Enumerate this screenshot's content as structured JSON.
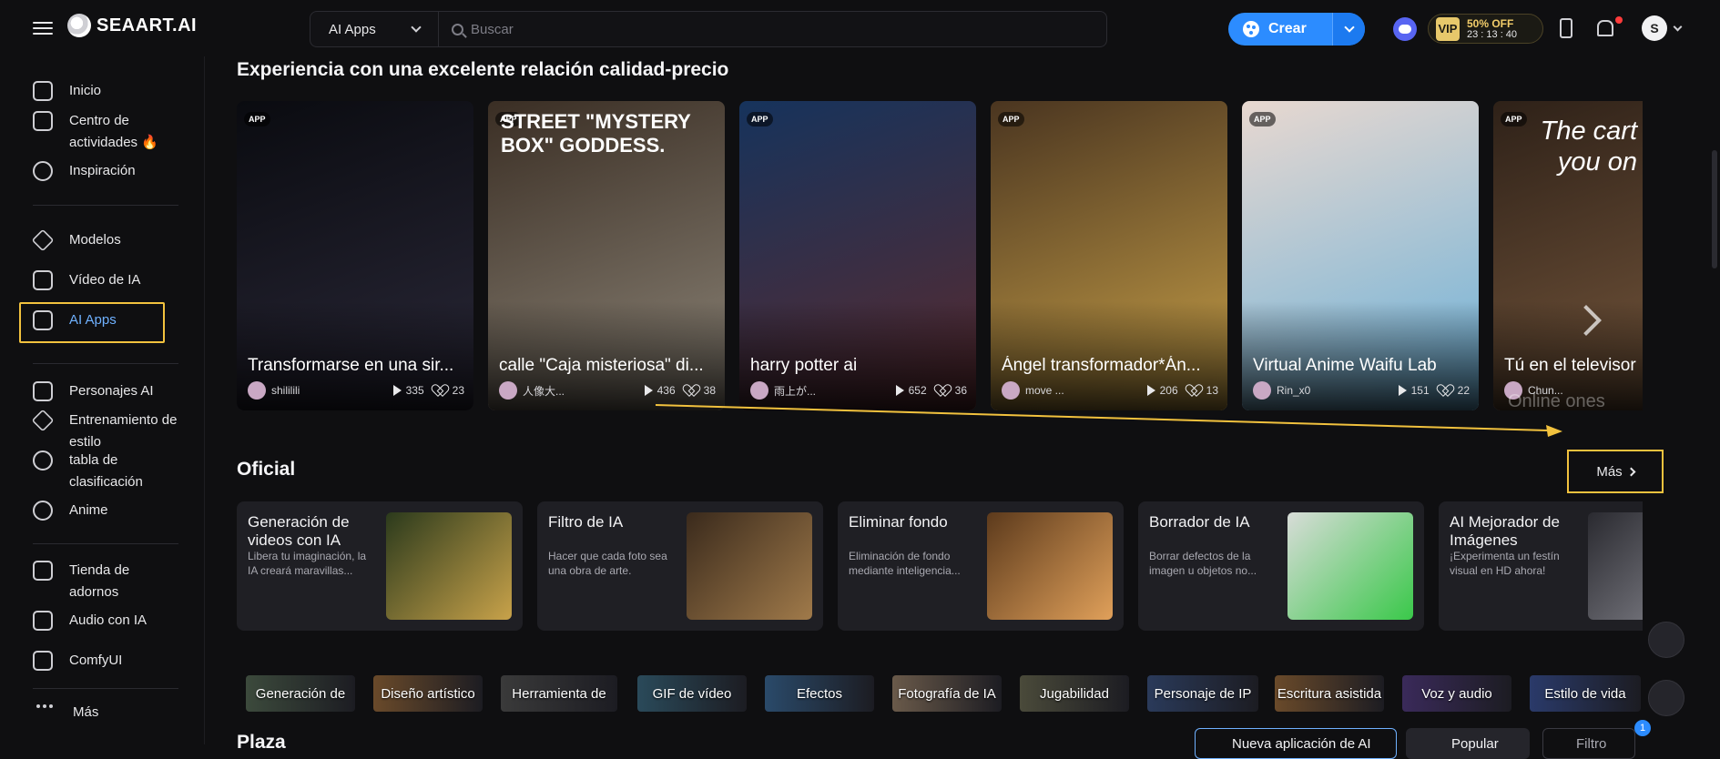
{
  "brand": {
    "name": "SEAART.AI"
  },
  "header": {
    "search_category": "AI Apps",
    "search_placeholder": "Buscar",
    "create_label": "Crear",
    "vip_badge": "VIP",
    "vip_offer": "50% OFF",
    "vip_timer": "23 : 13 : 40",
    "avatar_letter": "S"
  },
  "sidebar": {
    "items": [
      {
        "label": "Inicio",
        "icon": "home-icon"
      },
      {
        "label": "Centro de\nactividades 🔥",
        "icon": "gift-icon"
      },
      {
        "label": "Inspiración",
        "icon": "sparkle-icon"
      },
      {
        "label": "Modelos",
        "icon": "cube-icon"
      },
      {
        "label": "Vídeo de IA",
        "icon": "video-icon"
      },
      {
        "label": "AI Apps",
        "icon": "apps-shield-icon"
      },
      {
        "label": "Personajes AI",
        "icon": "character-icon"
      },
      {
        "label": "Entrenamiento de\nestilo",
        "icon": "training-icon"
      },
      {
        "label": "tabla de\nclasificación",
        "icon": "trophy-icon"
      },
      {
        "label": "Anime",
        "icon": "anime-icon"
      },
      {
        "label": "Tienda de\nadornos",
        "icon": "shop-icon"
      },
      {
        "label": "Audio con IA",
        "icon": "audio-wave-icon"
      },
      {
        "label": "ComfyUI",
        "icon": "comfy-icon"
      }
    ],
    "more_label": "Más"
  },
  "sections": {
    "featured_title": "Experiencia con una excelente relación calidad-precio",
    "official_title": "Oficial",
    "more_label": "Más",
    "plaza_title": "Plaza"
  },
  "featured_cards": [
    {
      "badge": "APP",
      "title": "Transformarse en una sir...",
      "author": "shililili",
      "plays": "335",
      "likes": "23",
      "colors": [
        "#0a0b10",
        "#2a2838"
      ]
    },
    {
      "badge": "APP",
      "title": "calle \"Caja misteriosa\" di...",
      "author": "人像大...",
      "plays": "436",
      "likes": "38",
      "colors": [
        "#3a2e24",
        "#8d8578"
      ]
    },
    {
      "badge": "APP",
      "title": "harry potter ai",
      "author": "雨上が...",
      "plays": "652",
      "likes": "36",
      "colors": [
        "#16335c",
        "#5a2a2e"
      ]
    },
    {
      "badge": "APP",
      "title": "Ángel transformador*Án...",
      "author": "move ...",
      "plays": "206",
      "likes": "13",
      "colors": [
        "#4a3520",
        "#c9a148"
      ]
    },
    {
      "badge": "APP",
      "title": "Virtual Anime Waifu Lab",
      "author": "Rin_x0",
      "plays": "151",
      "likes": "22",
      "colors": [
        "#e8d8d0",
        "#6ab0d8"
      ]
    },
    {
      "badge": "APP",
      "title": "Tú en el televisor",
      "author": "Chun...",
      "plays": "",
      "likes": "",
      "colors": [
        "#2e2118",
        "#7a5a3e"
      ]
    }
  ],
  "featured_overlay_text": {
    "card2_headline": "STREET \"MYSTERY BOX\" GODDESS.",
    "card6_headline": "The cart you on",
    "card6_footer": "Online ones"
  },
  "official_cards": [
    {
      "title": "Generación de videos con IA",
      "desc": "Libera tu imaginación, la IA creará maravillas...",
      "colors": [
        "#2b3a1c",
        "#c8a24a"
      ]
    },
    {
      "title": "Filtro de IA",
      "desc": "Hacer que cada foto sea una obra de arte.",
      "colors": [
        "#3a2a1c",
        "#a07a4a"
      ]
    },
    {
      "title": "Eliminar fondo",
      "desc": "Eliminación de fondo mediante inteligencia...",
      "colors": [
        "#5c3a1c",
        "#e0a05a"
      ]
    },
    {
      "title": "Borrador de IA",
      "desc": "Borrar defectos de la imagen u objetos no...",
      "colors": [
        "#d8dcd8",
        "#3ac84a"
      ]
    },
    {
      "title": "AI Mejorador de Imágenes",
      "desc": "¡Experimenta un festín visual en HD ahora!",
      "colors": [
        "#2a2a30",
        "#8a8a92"
      ]
    }
  ],
  "categories": [
    {
      "label": "Generación de",
      "color": "#3c4a3c"
    },
    {
      "label": "Diseño artístico",
      "color": "#6a4a2a"
    },
    {
      "label": "Herramienta de",
      "color": "#3a3a3a"
    },
    {
      "label": "GIF de vídeo",
      "color": "#2a4a5a"
    },
    {
      "label": "Efectos",
      "color": "#2a4a6a"
    },
    {
      "label": "Fotografía de IA",
      "color": "#6a5a4a"
    },
    {
      "label": "Jugabilidad",
      "color": "#4a4a3a"
    },
    {
      "label": "Personaje de IP",
      "color": "#2a3a5a"
    },
    {
      "label": "Escritura asistida",
      "color": "#6a4a2a"
    },
    {
      "label": "Voz y audio",
      "color": "#3a2a5a"
    },
    {
      "label": "Estilo de vida",
      "color": "#2a3a6a"
    }
  ],
  "plaza": {
    "new_app_label": "Nueva aplicación de AI",
    "sort_label": "Popular",
    "filter_label": "Filtro",
    "filter_count": "1"
  },
  "accent_colors": {
    "primary": "#2c8cff",
    "highlight": "#f2c23e",
    "vip": "#f2cd6a"
  }
}
